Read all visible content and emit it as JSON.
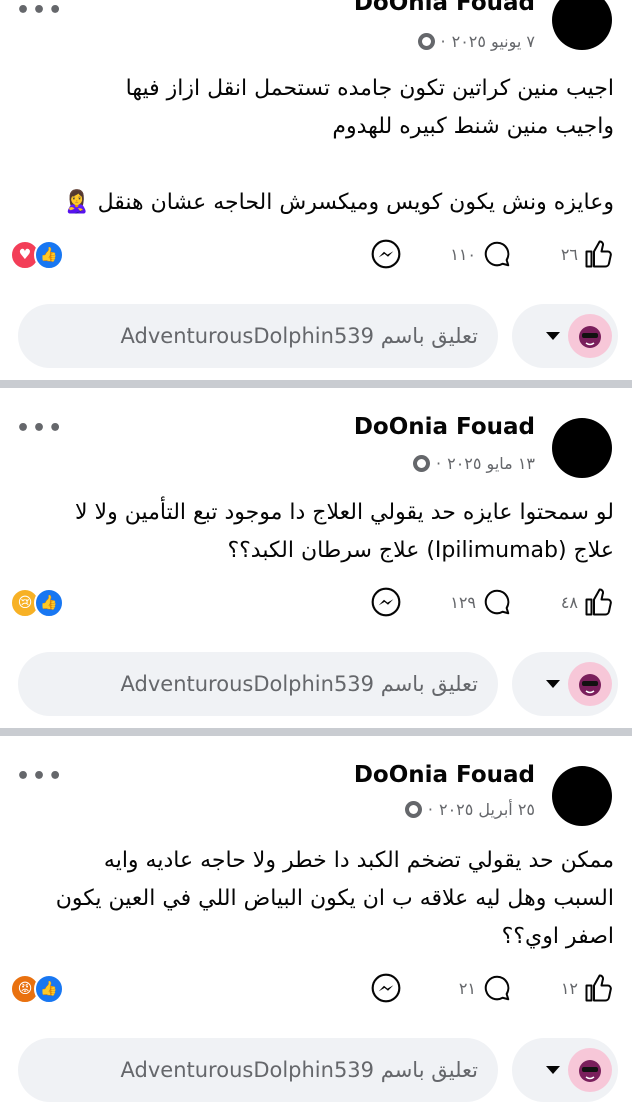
{
  "posts": [
    {
      "author": "DoOnia Fouad",
      "date": "٧ يونيو ٢٠٢٥",
      "dot": "·",
      "lines": [
        "اجيب منين كراتين تكون جامده تستحمل انقل ازاز فيها",
        "واجيب منين شنط كبيره للهدوم",
        "",
        "وعايزه ونش يكون كويس وميكسرش الحاجه عشان هنقل 🙎‍♀️"
      ],
      "likes": "٢٦",
      "comments": "١١٠",
      "reactions": [
        "like",
        "love"
      ]
    },
    {
      "author": "DoOnia Fouad",
      "date": "١٣ مايو ٢٠٢٥",
      "dot": "·",
      "lines": [
        "لو سمحتوا عايزه حد يقولي العلاج دا موجود تبع التأمين ولا لا",
        "علاج (Ipilimumab) علاج سرطان الكبد؟؟"
      ],
      "likes": "٤٨",
      "comments": "١٢٩",
      "reactions": [
        "like",
        "sad"
      ]
    },
    {
      "author": "DoOnia Fouad",
      "date": "٢٥ أبريل ٢٠٢٥",
      "dot": "·",
      "lines": [
        "ممكن حد يقولي تضخم الكبد دا خطر ولا حاجه عاديه وايه",
        "السبب وهل ليه علاقه ب ان يكون البياض اللي في العين يكون",
        "اصفر اوي؟؟"
      ],
      "likes": "١٢",
      "comments": "٢١",
      "reactions": [
        "like",
        "angry"
      ]
    }
  ],
  "comment_placeholder": "تعليق باسم AdventurousDolphin539",
  "icons": {
    "more": "more-options-icon",
    "globe": "privacy-globe-icon",
    "like": "like-thumb-icon",
    "comment": "comment-bubble-icon",
    "messenger": "messenger-share-icon"
  },
  "colors": {
    "accent": "#1877f2",
    "secondary_text": "#65676b",
    "separator": "#c9ccd1"
  }
}
